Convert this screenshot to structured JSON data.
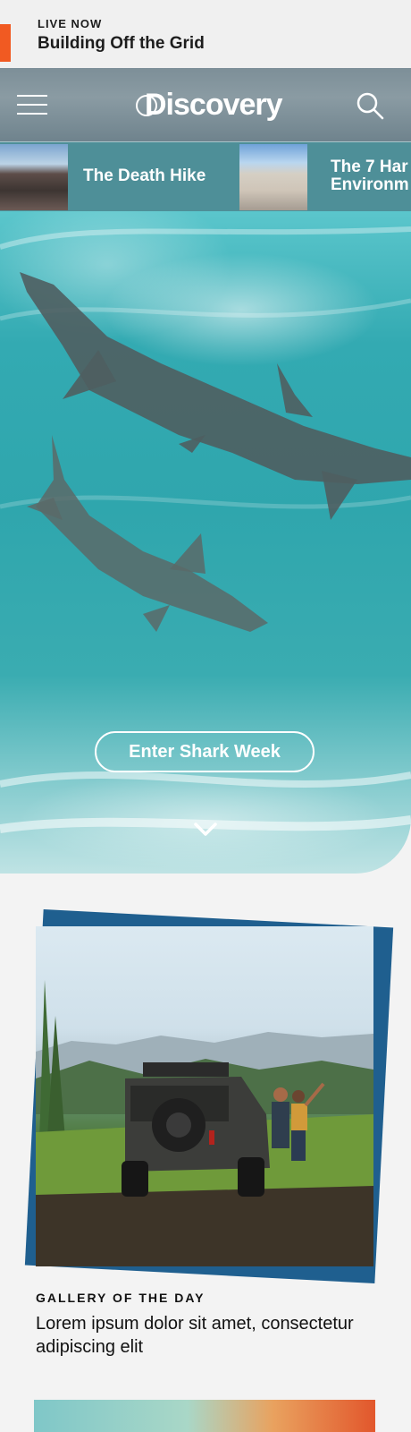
{
  "live": {
    "label": "LIVE NOW",
    "title": "Building Off the Grid"
  },
  "header": {
    "logo": "Discovery",
    "menu_icon": "hamburger-menu-icon",
    "search_icon": "search-icon"
  },
  "carousel": [
    {
      "title": "The Death Hike"
    },
    {
      "title_line1": "The 7 Har",
      "title_line2": "Environm"
    }
  ],
  "hero": {
    "cta_label": "Enter Shark Week",
    "scroll_icon": "chevron-down-icon"
  },
  "gallery": {
    "eyebrow": "GALLERY OF THE DAY",
    "headline": "Lorem ipsum dolor sit amet, consectetur adipiscing elit"
  },
  "colors": {
    "accent": "#f15a22",
    "card_frame": "#1f5f8f",
    "header": "#7d8f98"
  }
}
